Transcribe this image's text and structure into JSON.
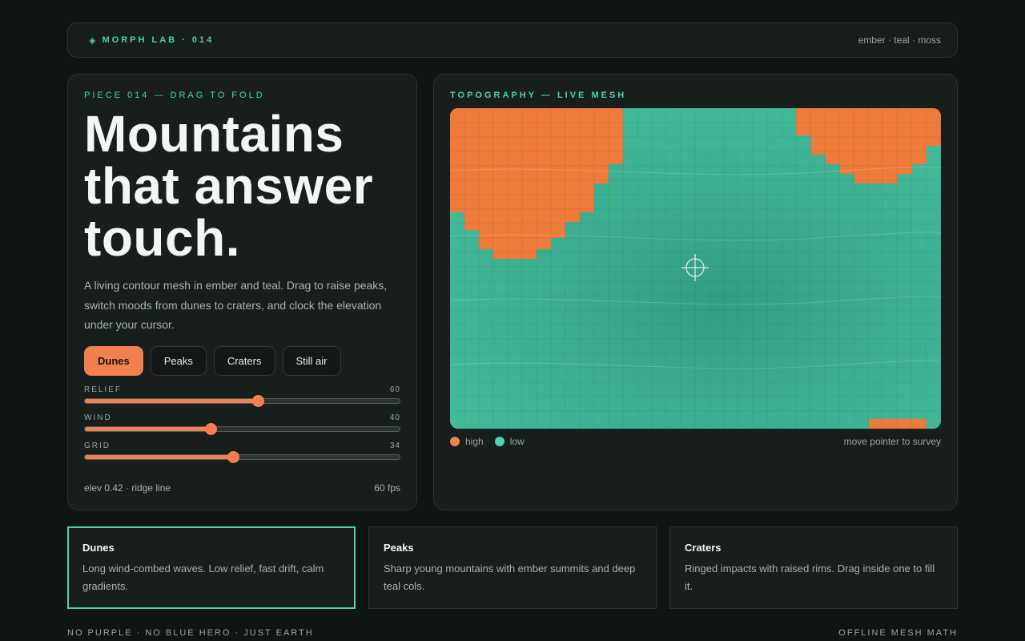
{
  "header": {
    "brand_icon": "diamond-icon",
    "brand_glyph": "◈",
    "brand": "MORPH LAB · 014",
    "palette": "ember · teal · moss"
  },
  "intro": {
    "eyebrow": "PIECE 014 — DRAG TO FOLD",
    "title_lines": [
      "Mountains",
      "that answer",
      "touch."
    ],
    "description": "A living contour mesh in ember and teal. Drag to raise peaks, switch moods from dunes to craters, and clock the elevation under your cursor."
  },
  "modes": [
    {
      "label": "Dunes",
      "active": true
    },
    {
      "label": "Peaks",
      "active": false
    },
    {
      "label": "Craters",
      "active": false
    },
    {
      "label": "Still air",
      "active": false
    }
  ],
  "sliders": [
    {
      "label": "RELIEF",
      "value": "60",
      "fraction": 0.55
    },
    {
      "label": "WIND",
      "value": "40",
      "fraction": 0.4
    },
    {
      "label": "GRID",
      "value": "34",
      "fraction": 0.47
    }
  ],
  "status": {
    "readout": "elev 0.42 · ridge line",
    "fps": "60 fps"
  },
  "mesh": {
    "eyebrow": "TOPOGRAPHY — LIVE MESH",
    "legend": [
      {
        "label": "high",
        "color": "#f08050"
      },
      {
        "label": "low",
        "color": "#4fd1b3"
      }
    ],
    "hint": "move pointer to survey",
    "colors": {
      "ember": "#ee7a3c",
      "teal": "#3fb797"
    },
    "cursor_icon": "crosshair-icon"
  },
  "cards": [
    {
      "title": "Dunes",
      "text": "Long wind-combed waves. Low relief, fast drift, calm gradients.",
      "active": true
    },
    {
      "title": "Peaks",
      "text": "Sharp young mountains with ember summits and deep teal cols.",
      "active": false
    },
    {
      "title": "Craters",
      "text": "Ringed impacts with raised rims. Drag inside one to fill it.",
      "active": false
    }
  ],
  "footer": {
    "left": "NO PURPLE · NO BLUE HERO · JUST EARTH",
    "right": "OFFLINE MESH MATH"
  },
  "accent": {
    "ember": "#f08050",
    "teal": "#4fd1b3"
  }
}
